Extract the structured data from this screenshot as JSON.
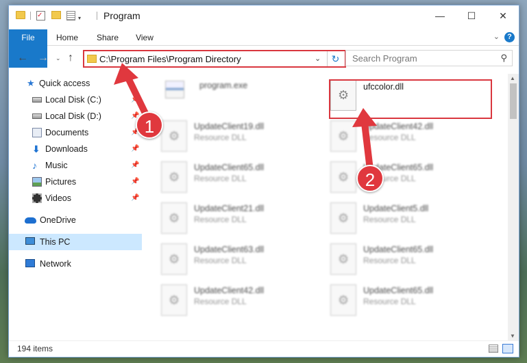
{
  "window": {
    "title": "Program",
    "min_glyph": "—",
    "max_glyph": "☐",
    "close_glyph": "✕"
  },
  "ribbon": {
    "tabs": [
      "File",
      "Home",
      "Share",
      "View"
    ],
    "help_glyph": "?",
    "collapse_glyph": "⌄"
  },
  "nav": {
    "back_glyph": "←",
    "forward_glyph": "→",
    "recent_glyph": "⌄",
    "up_glyph": "↑"
  },
  "address": {
    "path": "C:\\Program Files\\Program Directory",
    "dropdown_glyph": "⌄",
    "refresh_glyph": "↻"
  },
  "search": {
    "placeholder": "Search Program",
    "icon_glyph": "⚲"
  },
  "sidebar": {
    "items": [
      {
        "label": "Quick access",
        "icon": "star-icon",
        "pinned": false
      },
      {
        "label": "Local Disk (C:)",
        "icon": "drive-icon",
        "pinned": true
      },
      {
        "label": "Local Disk (D:)",
        "icon": "drive-icon",
        "pinned": true
      },
      {
        "label": "Documents",
        "icon": "documents-icon",
        "pinned": true
      },
      {
        "label": "Downloads",
        "icon": "downloads-icon",
        "pinned": true
      },
      {
        "label": "Music",
        "icon": "music-icon",
        "pinned": true
      },
      {
        "label": "Pictures",
        "icon": "pictures-icon",
        "pinned": true
      },
      {
        "label": "Videos",
        "icon": "videos-icon",
        "pinned": true
      },
      {
        "label": "OneDrive",
        "icon": "onedrive-icon",
        "pinned": false
      },
      {
        "label": "This PC",
        "icon": "computer-icon",
        "pinned": false,
        "selected": true
      },
      {
        "label": "Network",
        "icon": "network-icon",
        "pinned": false
      }
    ],
    "pin_glyph": "📌"
  },
  "files": {
    "left": [
      {
        "name": "program.exe",
        "type": ""
      },
      {
        "name": "UpdateClient19.dll",
        "type": "Resource DLL"
      },
      {
        "name": "UpdateClient65.dll",
        "type": "Resource DLL"
      },
      {
        "name": "UpdateClient21.dll",
        "type": "Resource DLL"
      },
      {
        "name": "UpdateClient63.dll",
        "type": "Resource DLL"
      },
      {
        "name": "UpdateClient42.dll",
        "type": "Resource DLL"
      }
    ],
    "right": [
      {
        "name": "ufccolor.dll",
        "type": ""
      },
      {
        "name": "UpdateClient42.dll",
        "type": "Resource DLL"
      },
      {
        "name": "UpdateClient65.dll",
        "type": "Resource DLL"
      },
      {
        "name": "UpdateClient5.dll",
        "type": "Resource DLL"
      },
      {
        "name": "UpdateClient65.dll",
        "type": "Resource DLL"
      },
      {
        "name": "UpdateClient65.dll",
        "type": "Resource DLL"
      }
    ]
  },
  "status": {
    "item_count": "194 items"
  },
  "callouts": [
    {
      "number": "1"
    },
    {
      "number": "2"
    }
  ],
  "colors": {
    "accent": "#1979ca",
    "highlight": "#d9363e",
    "selection": "#cce8ff"
  }
}
